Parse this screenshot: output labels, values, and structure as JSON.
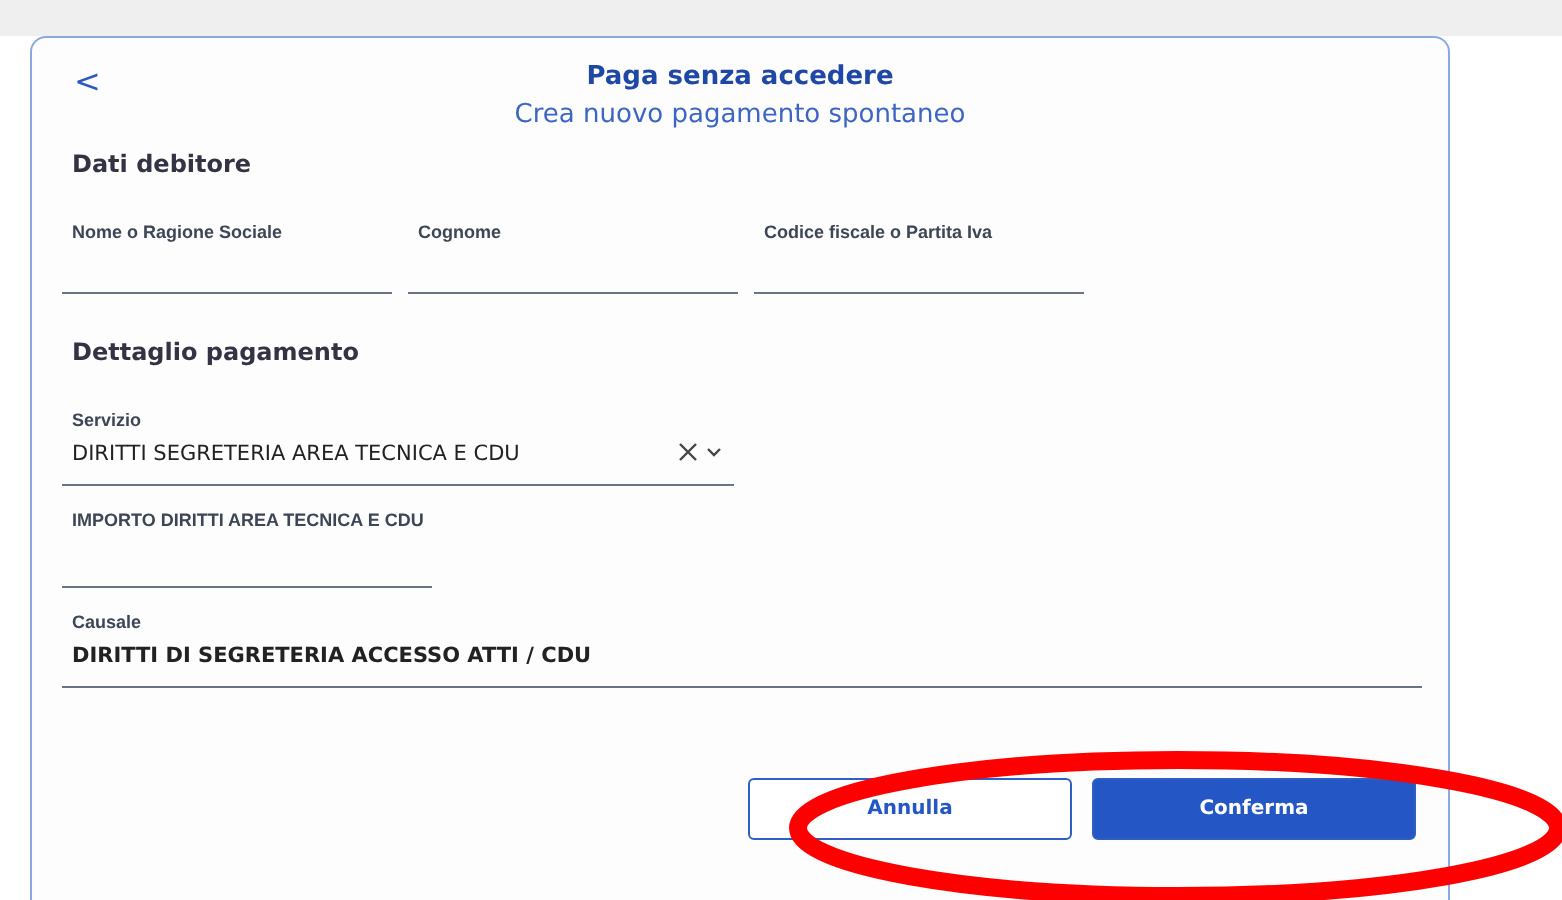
{
  "header": {
    "back": "<",
    "title": "Paga senza accedere",
    "subtitle": "Crea nuovo pagamento spontaneo"
  },
  "debtor": {
    "heading": "Dati debitore",
    "fields": [
      {
        "label": "Nome o Ragione Sociale"
      },
      {
        "label": "Cognome"
      },
      {
        "label": "Codice fiscale o Partita Iva"
      }
    ]
  },
  "payment": {
    "heading": "Dettaglio pagamento",
    "service": {
      "label": "Servizio",
      "value": "DIRITTI SEGRETERIA AREA TECNICA E CDU"
    },
    "amount": {
      "label": "IMPORTO DIRITTI AREA TECNICA E CDU"
    },
    "reason": {
      "label": "Causale",
      "value": "DIRITTI DI SEGRETERIA ACCESSO ATTI / CDU"
    }
  },
  "buttons": [
    {
      "kind": "secondary",
      "label": "Annulla"
    },
    {
      "kind": "primary",
      "label": "Conferma"
    }
  ]
}
